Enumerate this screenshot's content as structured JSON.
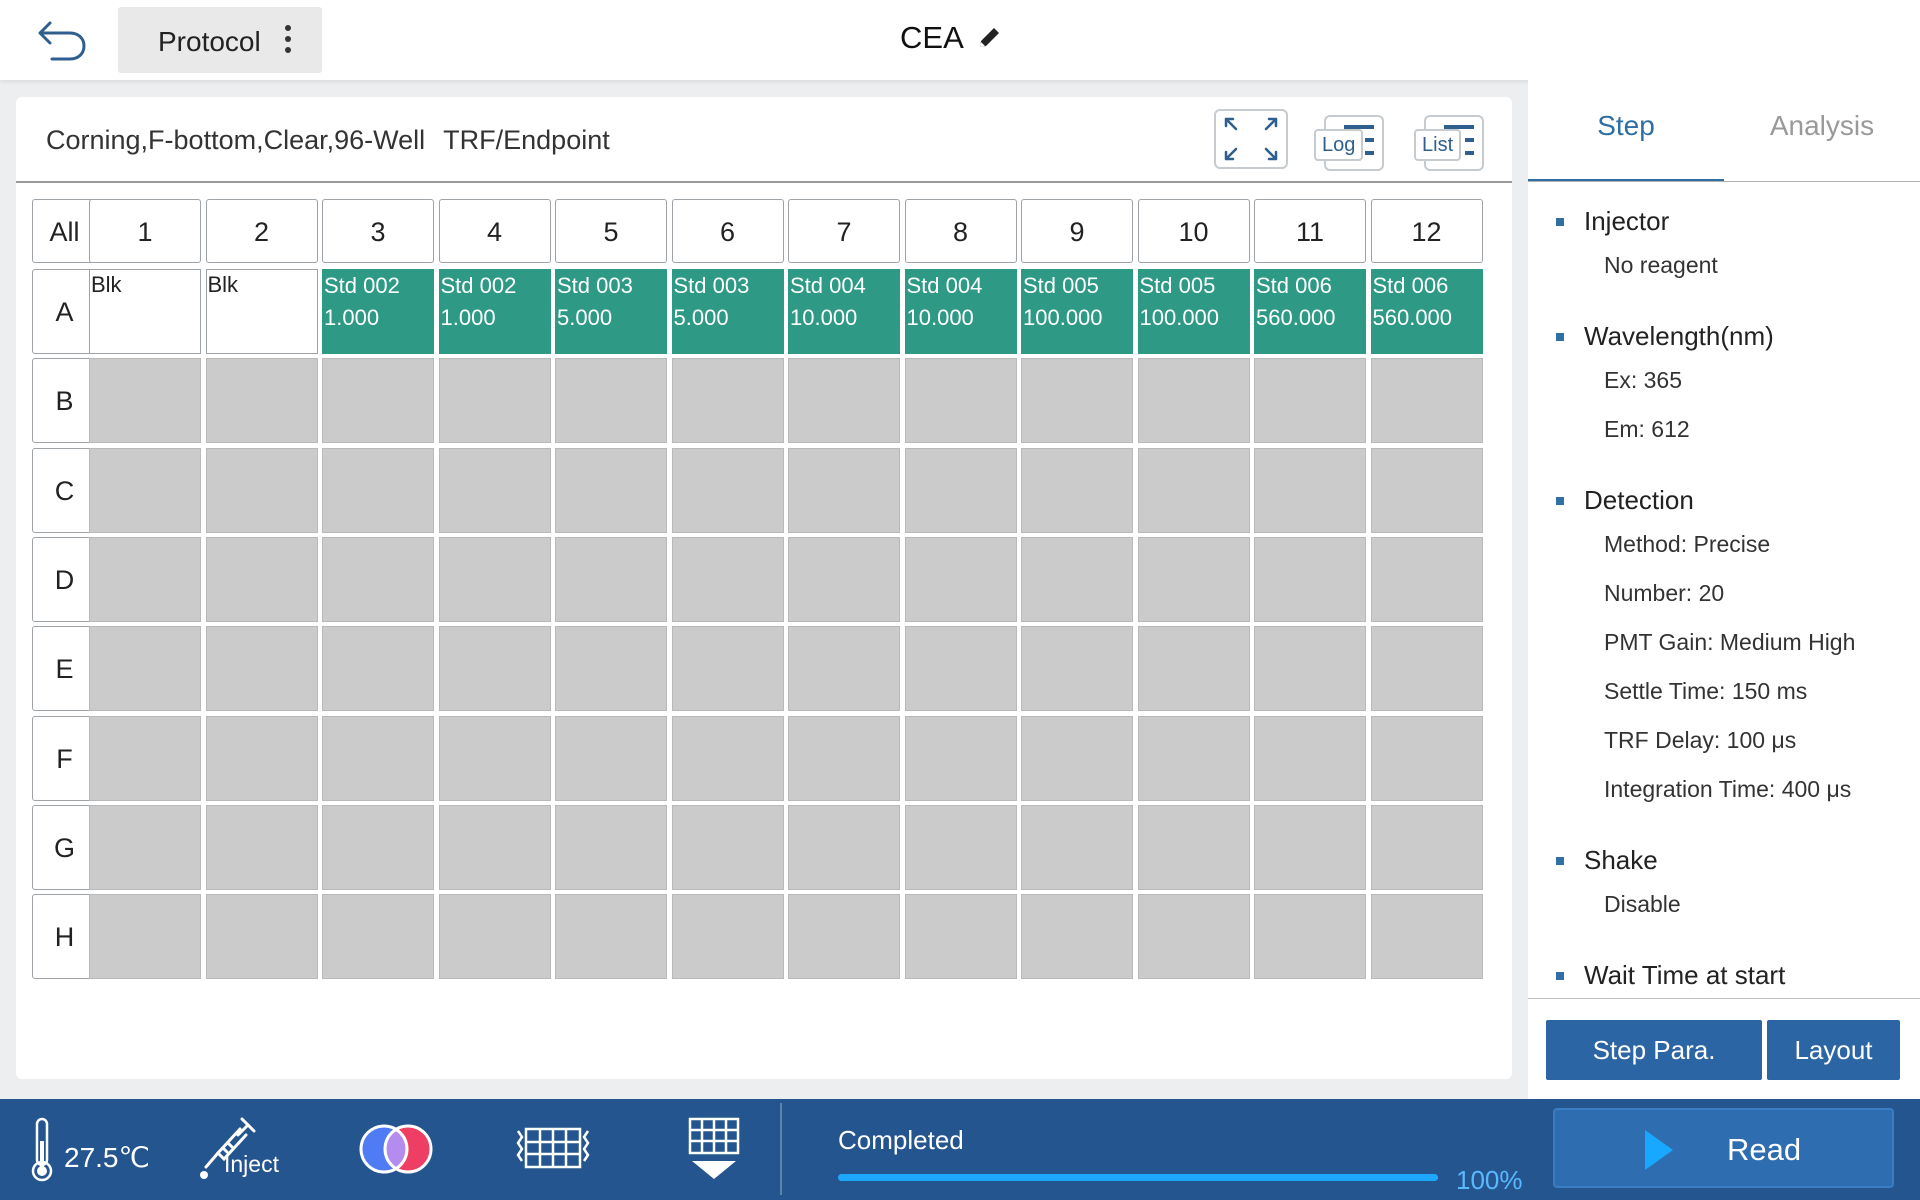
{
  "header": {
    "title": "CEA",
    "protocol_label": "Protocol"
  },
  "plate": {
    "info": "Corning,F-bottom,Clear,96-Well",
    "mode": "TRF/Endpoint",
    "toolbar": {
      "log_label": "Log",
      "list_label": "List"
    },
    "all_label": "All",
    "columns": [
      "1",
      "2",
      "3",
      "4",
      "5",
      "6",
      "7",
      "8",
      "9",
      "10",
      "11",
      "12"
    ],
    "rows": [
      "A",
      "B",
      "C",
      "D",
      "E",
      "F",
      "G",
      "H"
    ],
    "row_a_wells": [
      {
        "name": "Blk",
        "conc": ""
      },
      {
        "name": "Blk",
        "conc": ""
      },
      {
        "name": "Std 002",
        "conc": "1.000"
      },
      {
        "name": "Std 002",
        "conc": "1.000"
      },
      {
        "name": "Std 003",
        "conc": "5.000"
      },
      {
        "name": "Std 003",
        "conc": "5.000"
      },
      {
        "name": "Std 004",
        "conc": "10.000"
      },
      {
        "name": "Std 004",
        "conc": "10.000"
      },
      {
        "name": "Std 005",
        "conc": "100.000"
      },
      {
        "name": "Std 005",
        "conc": "100.000"
      },
      {
        "name": "Std 006",
        "conc": "560.000"
      },
      {
        "name": "Std 006",
        "conc": "560.000"
      }
    ]
  },
  "side": {
    "tabs": {
      "step": "Step",
      "analysis": "Analysis"
    },
    "params": {
      "injector": {
        "heading": "Injector",
        "value": "No reagent"
      },
      "wavelength": {
        "heading": "Wavelength(nm)",
        "ex": "Ex: 365",
        "em": "Em: 612"
      },
      "detection": {
        "heading": "Detection",
        "method": "Method: Precise",
        "number": "Number: 20",
        "pmt_gain": "PMT Gain: Medium High",
        "settle_time": "Settle Time: 150 ms",
        "trf_delay": "TRF Delay: 100 μs",
        "integration_time": "Integration Time: 400 μs"
      },
      "shake": {
        "heading": "Shake",
        "value": "Disable"
      },
      "wait_time": {
        "heading": "Wait Time at start"
      }
    },
    "buttons": {
      "step_para": "Step Para.",
      "layout": "Layout"
    }
  },
  "bottom": {
    "temperature": "27.5℃",
    "inject_label": "Inject",
    "status": "Completed",
    "progress": 100,
    "progress_label": "100%",
    "read_label": "Read"
  },
  "colors": {
    "accent": "#2f6fa3",
    "standard_well": "#2e9a85",
    "empty_well": "#cbcbcb",
    "bottom_bar": "#24558f",
    "progress": "#1ea7ff"
  }
}
